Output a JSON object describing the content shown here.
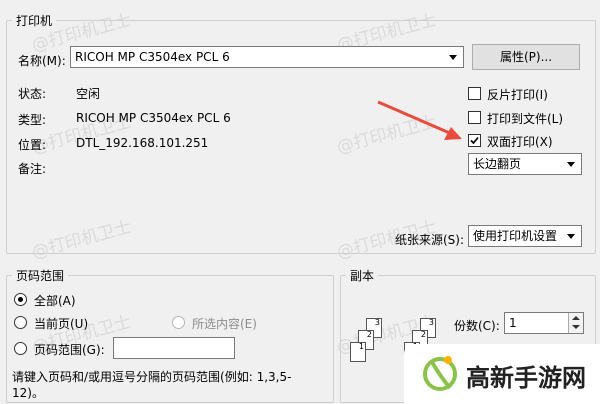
{
  "printer_group": {
    "title": "打印机",
    "name_label": "名称(M):",
    "printer_name": "RICOH MP C3504ex PCL 6",
    "properties_button": "属性(P)...",
    "status_label": "状态:",
    "status_value": "空闲",
    "type_label": "类型:",
    "type_value": "RICOH MP C3504ex PCL 6",
    "location_label": "位置:",
    "location_value": "DTL_192.168.101.251",
    "comment_label": "备注:",
    "reverse_print": "反片打印(I)",
    "print_to_file": "打印到文件(L)",
    "duplex": "双面打印(X)",
    "flip_option": "长边翻页",
    "paper_source_label": "纸张来源(S):",
    "paper_source_value": "使用打印机设置"
  },
  "checkbox_states": {
    "reverse_print": false,
    "print_to_file": false,
    "duplex": true
  },
  "page_range_group": {
    "title": "页码范围",
    "all": "全部(A)",
    "current_page": "当前页(U)",
    "selection": "所选内容(E)",
    "page_range": "页码范围(G):",
    "hint": "请键入页码和/或用逗号分隔的页码范围(例如: 1,3,5-12)。"
  },
  "copies_group": {
    "title": "副本",
    "copies_label": "份数(C):",
    "copies_value": "1"
  },
  "watermark_text": "@打印机卫士",
  "brand": {
    "text": "高新手游网",
    "accent": "#8bc34a"
  },
  "colors": {
    "arrow": "#e74c3c"
  }
}
